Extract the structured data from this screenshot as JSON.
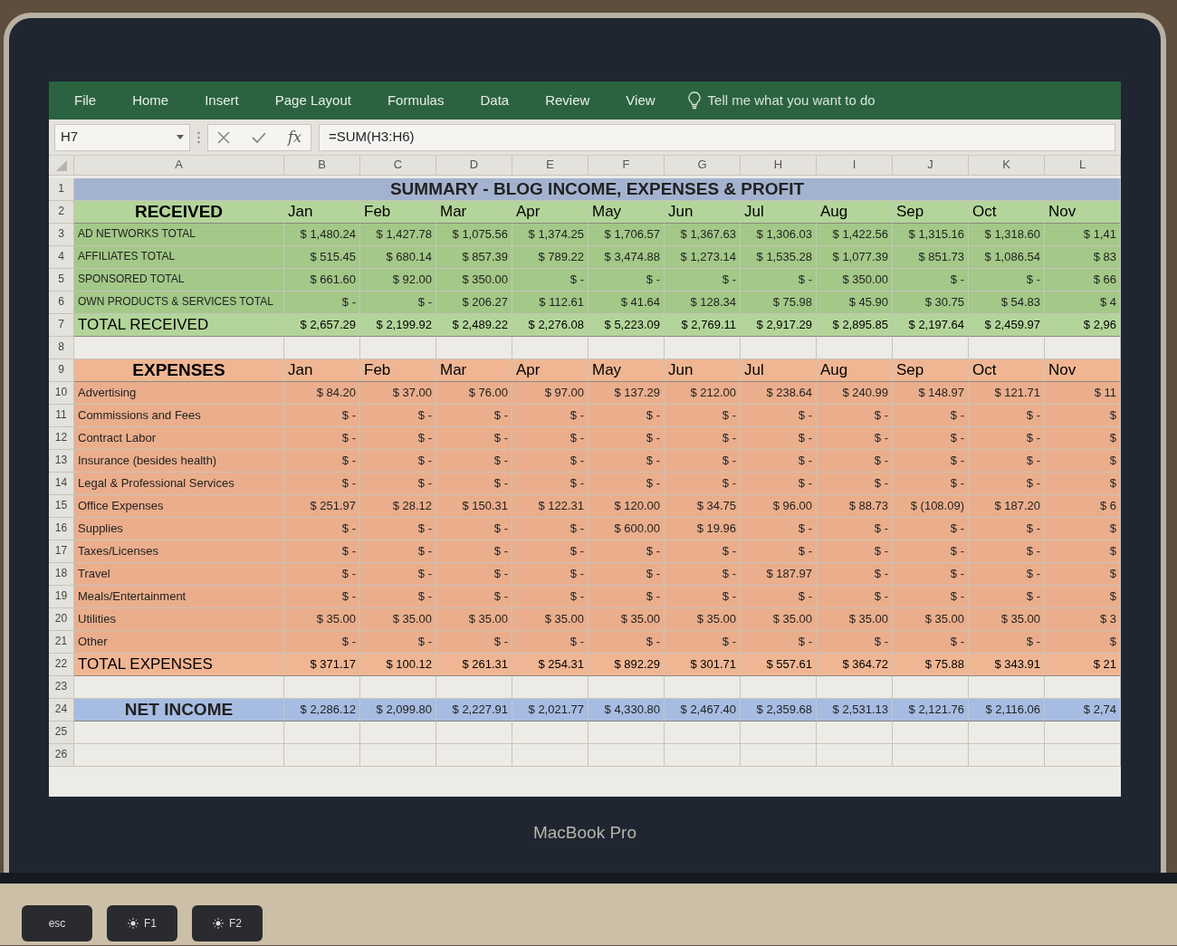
{
  "ribbon": {
    "tabs": [
      {
        "label": "File"
      },
      {
        "label": "Home"
      },
      {
        "label": "Insert"
      },
      {
        "label": "Page Layout"
      },
      {
        "label": "Formulas"
      },
      {
        "label": "Data"
      },
      {
        "label": "Review"
      },
      {
        "label": "View"
      }
    ],
    "tell_me": "Tell me what you want to do"
  },
  "formula_bar": {
    "name_box": "H7",
    "function_label": "fx",
    "formula": "=SUM(H3:H6)"
  },
  "sheet": {
    "columns": [
      "A",
      "B",
      "C",
      "D",
      "E",
      "F",
      "G",
      "H",
      "I",
      "J",
      "K",
      "L"
    ],
    "row_numbers": [
      "1",
      "2",
      "3",
      "4",
      "5",
      "6",
      "7",
      "8",
      "9",
      "10",
      "11",
      "12",
      "13",
      "14",
      "15",
      "16",
      "17",
      "18",
      "19",
      "20",
      "21",
      "22",
      "23",
      "24",
      "25",
      "26"
    ],
    "title": "SUMMARY - BLOG INCOME, EXPENSES & PROFIT",
    "received": {
      "heading": "RECEIVED",
      "months": [
        "Jan",
        "Feb",
        "Mar",
        "Apr",
        "May",
        "Jun",
        "Jul",
        "Aug",
        "Sep",
        "Oct",
        "Nov"
      ],
      "rows": [
        {
          "label": "AD NETWORKS TOTAL",
          "values": [
            "$ 1,480.24",
            "$ 1,427.78",
            "$ 1,075.56",
            "$ 1,374.25",
            "$ 1,706.57",
            "$ 1,367.63",
            "$ 1,306.03",
            "$ 1,422.56",
            "$ 1,315.16",
            "$ 1,318.60",
            "$ 1,41"
          ]
        },
        {
          "label": "AFFILIATES TOTAL",
          "values": [
            "$ 515.45",
            "$ 680.14",
            "$ 857.39",
            "$ 789.22",
            "$ 3,474.88",
            "$ 1,273.14",
            "$ 1,535.28",
            "$ 1,077.39",
            "$ 851.73",
            "$ 1,086.54",
            "$ 83"
          ]
        },
        {
          "label": "SPONSORED TOTAL",
          "values": [
            "$ 661.60",
            "$ 92.00",
            "$ 350.00",
            "$ -",
            "$ -",
            "$ -",
            "$ -",
            "$ 350.00",
            "$ -",
            "$ -",
            "$ 66"
          ]
        },
        {
          "label": "OWN PRODUCTS & SERVICES TOTAL",
          "values": [
            "$ -",
            "$ -",
            "$ 206.27",
            "$ 112.61",
            "$ 41.64",
            "$ 128.34",
            "$ 75.98",
            "$ 45.90",
            "$ 30.75",
            "$ 54.83",
            "$ 4"
          ]
        }
      ],
      "total": {
        "label": "TOTAL RECEIVED",
        "values": [
          "$ 2,657.29",
          "$ 2,199.92",
          "$ 2,489.22",
          "$ 2,276.08",
          "$ 5,223.09",
          "$ 2,769.11",
          "$ 2,917.29",
          "$ 2,895.85",
          "$ 2,197.64",
          "$ 2,459.97",
          "$ 2,96"
        ]
      }
    },
    "expenses": {
      "heading": "EXPENSES",
      "months": [
        "Jan",
        "Feb",
        "Mar",
        "Apr",
        "May",
        "Jun",
        "Jul",
        "Aug",
        "Sep",
        "Oct",
        "Nov"
      ],
      "rows": [
        {
          "label": "Advertising",
          "values": [
            "$ 84.20",
            "$ 37.00",
            "$ 76.00",
            "$ 97.00",
            "$ 137.29",
            "$ 212.00",
            "$ 238.64",
            "$ 240.99",
            "$ 148.97",
            "$ 121.71",
            "$ 11"
          ]
        },
        {
          "label": "Commissions and Fees",
          "values": [
            "$ -",
            "$ -",
            "$ -",
            "$ -",
            "$ -",
            "$ -",
            "$ -",
            "$ -",
            "$ -",
            "$ -",
            "$"
          ]
        },
        {
          "label": "Contract Labor",
          "values": [
            "$ -",
            "$ -",
            "$ -",
            "$ -",
            "$ -",
            "$ -",
            "$ -",
            "$ -",
            "$ -",
            "$ -",
            "$"
          ]
        },
        {
          "label": "Insurance (besides health)",
          "values": [
            "$ -",
            "$ -",
            "$ -",
            "$ -",
            "$ -",
            "$ -",
            "$ -",
            "$ -",
            "$ -",
            "$ -",
            "$"
          ]
        },
        {
          "label": "Legal & Professional Services",
          "values": [
            "$ -",
            "$ -",
            "$ -",
            "$ -",
            "$ -",
            "$ -",
            "$ -",
            "$ -",
            "$ -",
            "$ -",
            "$"
          ]
        },
        {
          "label": "Office Expenses",
          "values": [
            "$ 251.97",
            "$ 28.12",
            "$ 150.31",
            "$ 122.31",
            "$ 120.00",
            "$ 34.75",
            "$ 96.00",
            "$ 88.73",
            "$ (108.09)",
            "$ 187.20",
            "$ 6"
          ]
        },
        {
          "label": "Supplies",
          "values": [
            "$ -",
            "$ -",
            "$ -",
            "$ -",
            "$ 600.00",
            "$ 19.96",
            "$ -",
            "$ -",
            "$ -",
            "$ -",
            "$"
          ]
        },
        {
          "label": "Taxes/Licenses",
          "values": [
            "$ -",
            "$ -",
            "$ -",
            "$ -",
            "$ -",
            "$ -",
            "$ -",
            "$ -",
            "$ -",
            "$ -",
            "$"
          ]
        },
        {
          "label": "Travel",
          "values": [
            "$ -",
            "$ -",
            "$ -",
            "$ -",
            "$ -",
            "$ -",
            "$ 187.97",
            "$ -",
            "$ -",
            "$ -",
            "$"
          ]
        },
        {
          "label": "Meals/Entertainment",
          "values": [
            "$ -",
            "$ -",
            "$ -",
            "$ -",
            "$ -",
            "$ -",
            "$ -",
            "$ -",
            "$ -",
            "$ -",
            "$"
          ]
        },
        {
          "label": "Utilities",
          "values": [
            "$ 35.00",
            "$ 35.00",
            "$ 35.00",
            "$ 35.00",
            "$ 35.00",
            "$ 35.00",
            "$ 35.00",
            "$ 35.00",
            "$ 35.00",
            "$ 35.00",
            "$ 3"
          ]
        },
        {
          "label": "Other",
          "values": [
            "$ -",
            "$ -",
            "$ -",
            "$ -",
            "$ -",
            "$ -",
            "$ -",
            "$ -",
            "$ -",
            "$ -",
            "$"
          ]
        }
      ],
      "total": {
        "label": "TOTAL EXPENSES",
        "values": [
          "$ 371.17",
          "$ 100.12",
          "$ 261.31",
          "$ 254.31",
          "$ 892.29",
          "$ 301.71",
          "$ 557.61",
          "$ 364.72",
          "$ 75.88",
          "$ 343.91",
          "$ 21"
        ]
      }
    },
    "net_income": {
      "label": "NET INCOME",
      "values": [
        "$ 2,286.12",
        "$ 2,099.80",
        "$ 2,227.91",
        "$ 2,021.77",
        "$ 4,330.80",
        "$ 2,467.40",
        "$ 2,359.68",
        "$ 2,531.13",
        "$ 2,121.76",
        "$ 2,116.06",
        "$ 2,74"
      ]
    }
  },
  "device": {
    "brand_label": "MacBook Pro",
    "keys": [
      "esc",
      "F1",
      "F2"
    ]
  }
}
